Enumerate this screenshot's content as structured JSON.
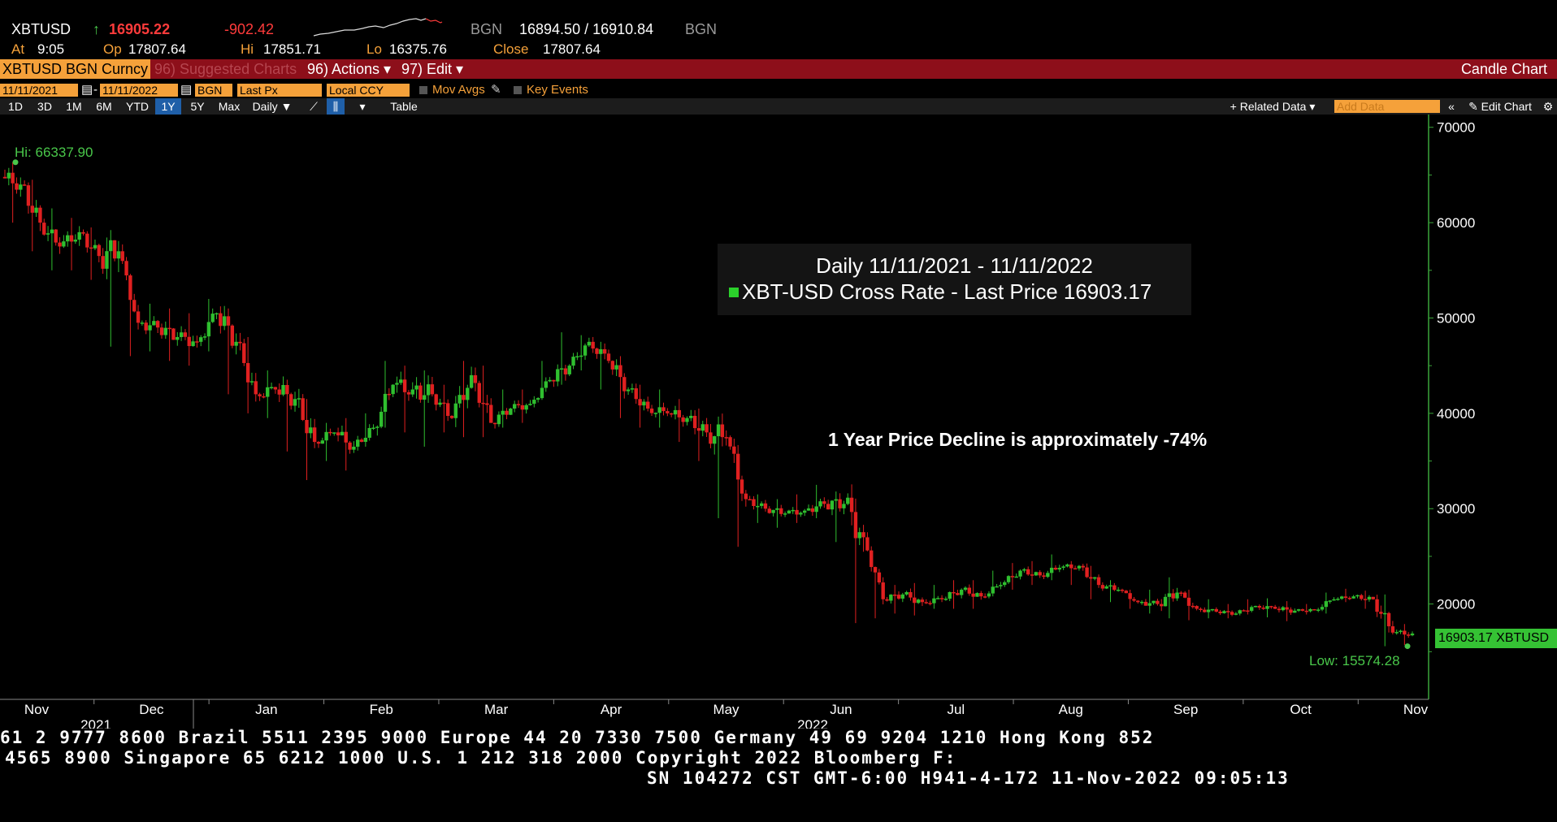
{
  "quote": {
    "ticker": "XBTUSD",
    "arrow": "↑",
    "last": "16905.22",
    "change": "-902.42",
    "source": "BGN",
    "bid_ask": "16894.50 / 16910.84",
    "source2": "BGN",
    "at_label": "At",
    "at_time": "9:05",
    "op_label": "Op",
    "op": "17807.64",
    "hi_label": "Hi",
    "hi": "17851.71",
    "lo_label": "Lo",
    "lo": "16375.76",
    "close_label": "Close",
    "close": "17807.64"
  },
  "function_bar": {
    "security": "XBTUSD BGN Curncy",
    "suggested": "96) Suggested Charts",
    "actions": "96) Actions ▾",
    "edit": "97) Edit ▾",
    "view": "Candle Chart"
  },
  "controls": {
    "start_date": "11/11/2021",
    "dash": "-",
    "end_date": "11/11/2022",
    "source": "BGN",
    "field": "Last Px",
    "currency": "Local CCY",
    "mov_avgs": "Mov Avgs",
    "key_events": "Key Events",
    "periods": [
      "1D",
      "3D",
      "1M",
      "6M",
      "YTD",
      "1Y",
      "5Y",
      "Max"
    ],
    "selected_period": "1Y",
    "frequency": "Daily ▼",
    "table": "Table",
    "related_data": "+ Related Data ▾",
    "add_data": "Add Data",
    "edit_chart": "✎ Edit Chart"
  },
  "chart_data": {
    "type": "candlestick",
    "legend_title": "Daily 11/11/2021 - 11/11/2022",
    "series_name": "XBT-USD Cross Rate - Last Price",
    "last_value": "16903.17",
    "annotation": "1 Year Price Decline is approximately -74%",
    "hi_label": "Hi: 66337.90",
    "low_label": "Low: 15574.28",
    "price_tag": "16903.17 XBTUSD",
    "ylim": [
      10000,
      71000
    ],
    "yticks": [
      20000,
      30000,
      40000,
      50000,
      60000,
      70000
    ],
    "month_labels": [
      "Nov",
      "Dec",
      "Jan",
      "Feb",
      "Mar",
      "Apr",
      "May",
      "Jun",
      "Jul",
      "Aug",
      "Sep",
      "Oct",
      "Nov"
    ],
    "year_labels": [
      "2021",
      "2022"
    ],
    "colors": {
      "up": "#2fbf2f",
      "down": "#e02020",
      "axis": "#3aa53a"
    },
    "weekly_close": [
      64000,
      60000,
      57500,
      59000,
      56500,
      57000,
      49500,
      49000,
      48000,
      47500,
      50500,
      47500,
      42000,
      42500,
      41500,
      37000,
      38000,
      36500,
      38500,
      43000,
      42500,
      42000,
      39500,
      44000,
      39000,
      40500,
      41000,
      43500,
      45000,
      47500,
      45500,
      42500,
      40500,
      40000,
      39500,
      38000,
      37500,
      31000,
      30000,
      29500,
      29800,
      30500,
      30500,
      27000,
      20500,
      21000,
      20200,
      20500,
      21500,
      20800,
      22000,
      23500,
      23000,
      23800,
      24000,
      22000,
      21500,
      20200,
      20000,
      21200,
      19500,
      19200,
      19000,
      19800,
      19500,
      19300,
      19400,
      20500,
      20800,
      20500,
      17000,
      16900
    ],
    "weekly_low": [
      60000,
      57000,
      55000,
      55000,
      54000,
      47000,
      46000,
      46500,
      45500,
      45000,
      46500,
      42000,
      40000,
      39500,
      36000,
      33000,
      35000,
      34000,
      36500,
      38500,
      38000,
      36500,
      38000,
      37500,
      37500,
      38500,
      39000,
      42000,
      43000,
      44500,
      42500,
      39500,
      38500,
      38500,
      37000,
      35000,
      29000,
      26000,
      28500,
      28000,
      28500,
      29000,
      26500,
      18000,
      18500,
      19000,
      18800,
      19500,
      19500,
      19500,
      20800,
      21500,
      22000,
      22500,
      22000,
      20500,
      20200,
      19500,
      19000,
      18500,
      18300,
      18500,
      18500,
      18900,
      18600,
      18200,
      18900,
      19000,
      20200,
      19500,
      15574,
      15700
    ],
    "weekly_high": [
      66338,
      64500,
      61500,
      60500,
      59500,
      59000,
      52000,
      51500,
      51000,
      50500,
      52000,
      51000,
      48000,
      44500,
      43500,
      41500,
      39000,
      39500,
      40000,
      45500,
      45000,
      44500,
      43000,
      45500,
      45000,
      42500,
      42500,
      45500,
      48500,
      48200,
      47500,
      46000,
      43000,
      42500,
      41500,
      40500,
      38500,
      34000,
      31500,
      31000,
      31500,
      32500,
      31800,
      30800,
      23000,
      22000,
      22200,
      22000,
      22500,
      22500,
      23500,
      24300,
      24500,
      25200,
      24500,
      24000,
      22500,
      21500,
      21500,
      22800,
      21500,
      20500,
      20000,
      20500,
      20600,
      20300,
      20000,
      21200,
      21600,
      21400,
      21000,
      17900
    ]
  },
  "footer": {
    "line1": "61 2 9777 8600 Brazil 5511 2395 9000 Europe 44 20 7330 7500 Germany 49 69 9204 1210 Hong Kong 852",
    "line2": "4565 8900       Singapore 65 6212 1000      U.S. 1 212 318 2000        Copyright 2022 Bloomberg F:",
    "line3": "SN 104272 CST  GMT-6:00 H941-4-172 11-Nov-2022 09:05:13"
  }
}
